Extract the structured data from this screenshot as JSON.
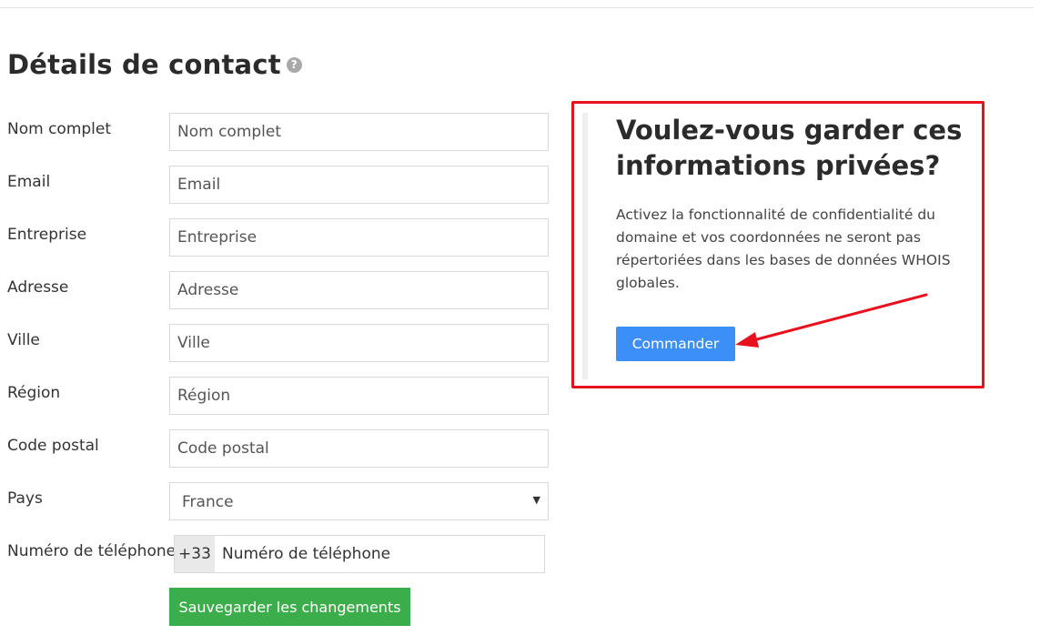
{
  "page_title": "Détails de contact",
  "help_icon_glyph": "?",
  "form": {
    "fields": [
      {
        "label": "Nom complet",
        "placeholder": "Nom complet"
      },
      {
        "label": "Email",
        "placeholder": "Email"
      },
      {
        "label": "Entreprise",
        "placeholder": "Entreprise"
      },
      {
        "label": "Adresse",
        "placeholder": "Adresse"
      },
      {
        "label": "Ville",
        "placeholder": "Ville"
      },
      {
        "label": "Région",
        "placeholder": "Région"
      },
      {
        "label": "Code postal",
        "placeholder": "Code postal"
      }
    ],
    "country": {
      "label": "Pays",
      "value": "France"
    },
    "phone": {
      "label": "Numéro de téléphone",
      "prefix": "+33",
      "placeholder": "Numéro de téléphone"
    },
    "save_label": "Sauvegarder les changements"
  },
  "privacy": {
    "title": "Voulez-vous garder ces informations privées?",
    "description": "Activez la fonctionnalité de confidentialité du domaine et vos coordonnées ne seront pas répertoriées dans les bases de données WHOIS globales.",
    "order_label": "Commander"
  },
  "icons": {
    "help": "help-circle-icon",
    "caret": "caret-down-icon",
    "annotation": "red-arrow-annotation"
  },
  "colors": {
    "save_button": "#3cad4b",
    "order_button": "#3b8ff6",
    "highlight_border": "#e8121f",
    "annotation_arrow": "#e8121f"
  }
}
